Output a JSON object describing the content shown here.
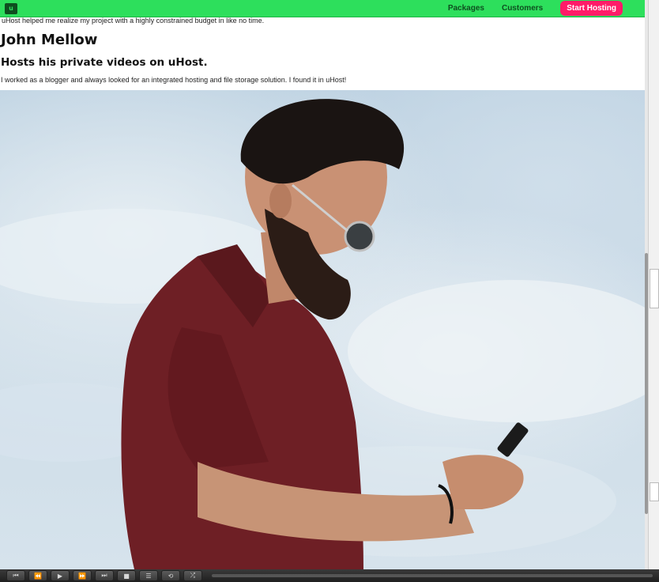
{
  "header": {
    "brand_text": "u",
    "nav": [
      {
        "label": "Packages"
      },
      {
        "label": "Customers"
      }
    ],
    "cta_label": "Start Hosting"
  },
  "testimonial_previous": {
    "text": "uHost helped me realize my project with a highly constrained budget in like no time."
  },
  "testimonial": {
    "name": "John Mellow",
    "subtitle": "Hosts his private videos on uHost.",
    "quote": "I worked as a blogger and always looked for an integrated hosting and file storage solution. I found it in uHost!"
  },
  "colors": {
    "header_bg": "#2ddf5c",
    "cta_bg": "#ff1b68",
    "nav_text": "#0e4f1f"
  },
  "player": {
    "controls": [
      "skip-back-icon",
      "rewind-icon",
      "play-icon",
      "fast-forward-icon",
      "skip-forward-icon",
      "stop-icon",
      "playlist-icon",
      "repeat-icon",
      "shuffle-icon"
    ]
  }
}
